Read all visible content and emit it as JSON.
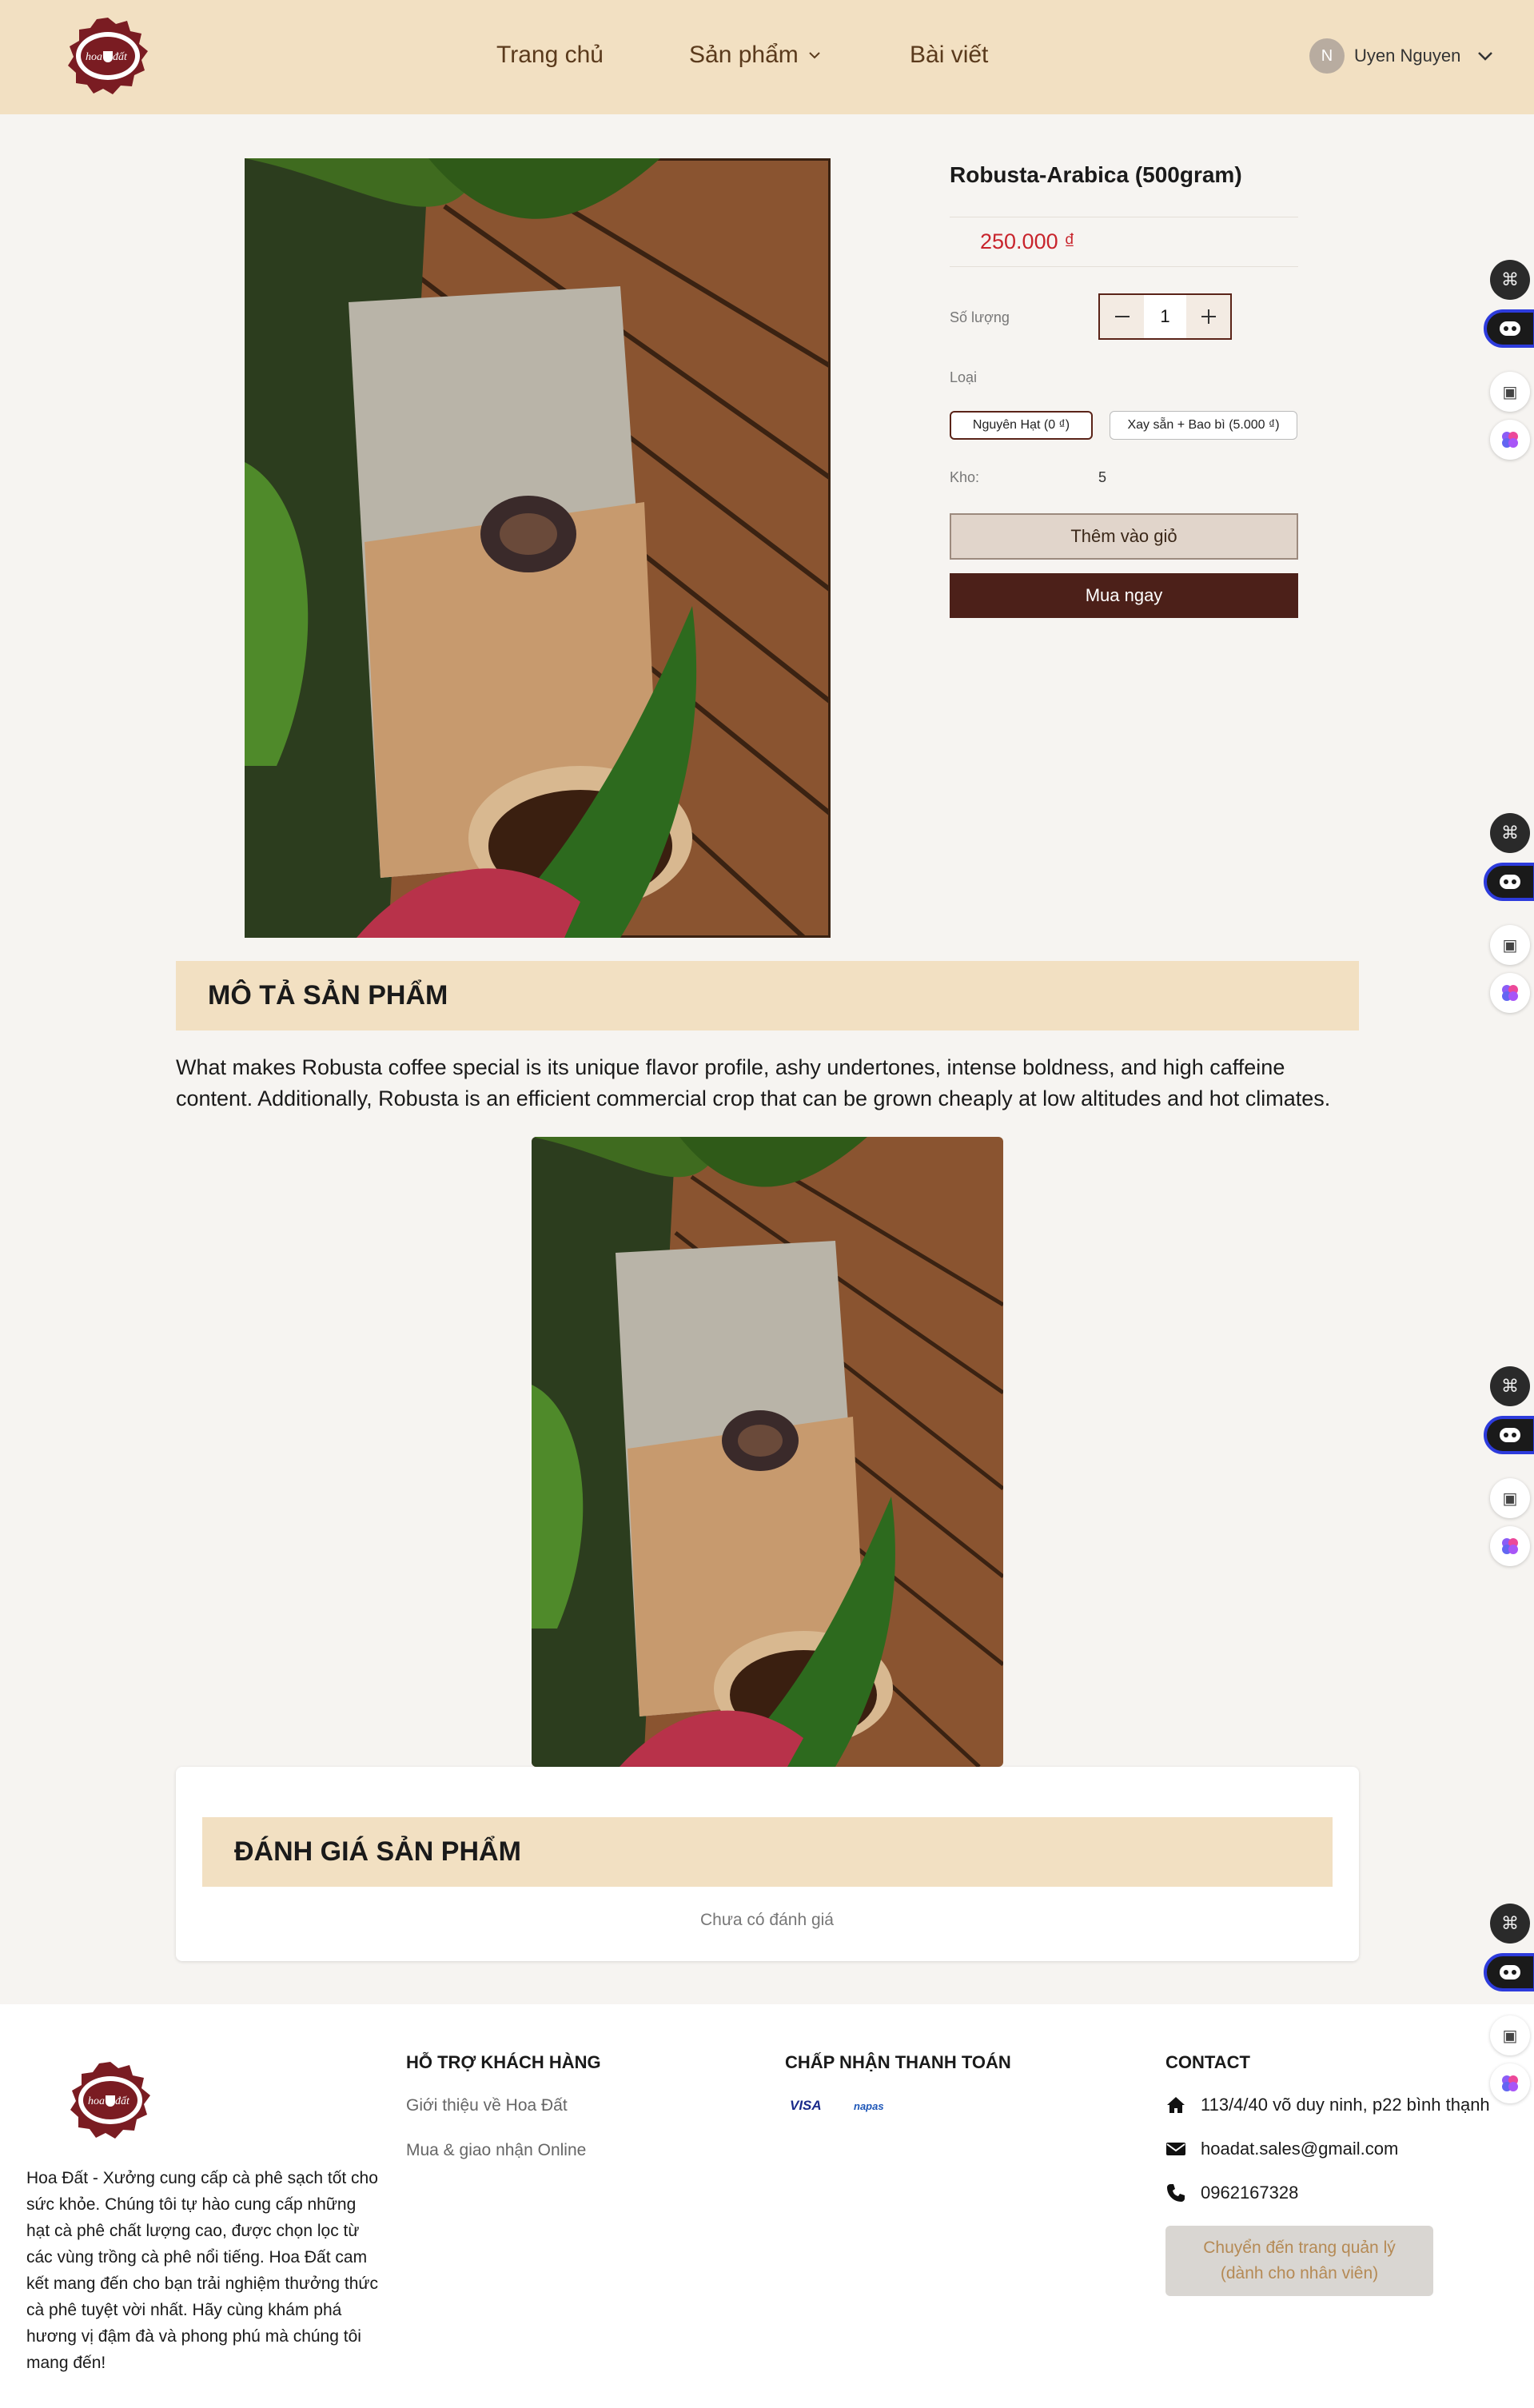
{
  "header": {
    "nav": {
      "home": "Trang chủ",
      "products": "Sản phẩm",
      "posts": "Bài viết"
    },
    "user": {
      "initial": "N",
      "name": "Uyen Nguyen"
    }
  },
  "product": {
    "title": "Robusta-Arabica (500gram)",
    "price": "250.000 ₫",
    "quantity_label": "Số lượng",
    "quantity": "1",
    "type_label": "Loại",
    "variants": [
      "Nguyên Hạt (0 ₫)",
      "Xay sẵn + Bao bì (5.000 ₫)"
    ],
    "selected_variant": "Nguyên Hạt (0 ₫)",
    "stock_label": "Kho:",
    "stock": "5",
    "add_to_cart": "Thêm vào giỏ",
    "buy_now": "Mua ngay"
  },
  "description": {
    "heading": "MÔ TẢ SẢN PHẨM",
    "text": "What makes Robusta coffee special is its unique flavor profile, ashy undertones, intense boldness, and high caffeine content. Additionally, Robusta is an efficient commercial crop that can be grown cheaply at low altitudes and hot climates."
  },
  "reviews": {
    "heading": "ĐÁNH GIÁ SẢN PHẨM",
    "empty": "Chưa có đánh giá"
  },
  "footer": {
    "about": "Hoa Đất - Xưởng cung cấp cà phê sạch tốt cho sức khỏe. Chúng tôi tự hào cung cấp những hạt cà phê chất lượng cao, được chọn lọc từ các vùng trồng cà phê nổi tiếng. Hoa Đất cam kết mang đến cho bạn trải nghiệm thưởng thức cà phê tuyệt vời nhất. Hãy cùng khám phá hương vị đậm đà và phong phú mà chúng tôi mang đến!",
    "support": {
      "title": "HỖ TRỢ KHÁCH HÀNG",
      "links": [
        "Giới thiệu về Hoa Đất",
        "Mua & giao nhận Online"
      ]
    },
    "payment": {
      "title": "CHẤP NHẬN THANH TOÁN",
      "methods": [
        "VISA",
        "napas"
      ]
    },
    "contact": {
      "title": "CONTACT",
      "address": "113/4/40 võ duy ninh, p22 bình thạnh",
      "email": "hoadat.sales@gmail.com",
      "phone": "0962167328",
      "admin_line1": "Chuyển đến trang quản lý",
      "admin_line2": "(dành cho nhân viên)"
    }
  },
  "colors": {
    "header_bg": "#f2e0c2",
    "brand_dark": "#4c2019",
    "price_red": "#c8242c",
    "page_bg": "#f6f4f1"
  },
  "icons": {
    "nav_products": "chevron-down-icon",
    "user_menu": "chevron-down-icon",
    "address": "home-icon",
    "email": "mail-icon",
    "phone": "phone-icon",
    "float_widgets": [
      "command-icon",
      "bot-icon",
      "book-icon",
      "brain-icon"
    ]
  }
}
